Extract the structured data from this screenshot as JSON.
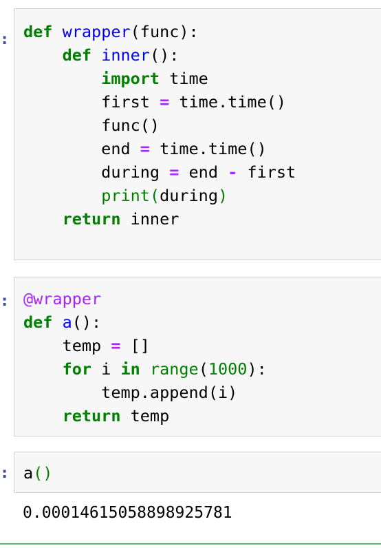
{
  "cells": [
    {
      "prompt": ":",
      "lines": [
        [
          [
            "kw",
            "def"
          ],
          [
            "t",
            " "
          ],
          [
            "def",
            "wrapper"
          ],
          [
            "t",
            "(func):"
          ]
        ],
        [
          [
            "t",
            "    "
          ],
          [
            "kw",
            "def"
          ],
          [
            "t",
            " "
          ],
          [
            "def",
            "inner"
          ],
          [
            "t",
            "():"
          ]
        ],
        [
          [
            "t",
            "        "
          ],
          [
            "kw",
            "import"
          ],
          [
            "t",
            " time"
          ]
        ],
        [
          [
            "t",
            "        first "
          ],
          [
            "op",
            "="
          ],
          [
            "t",
            " time.time()"
          ]
        ],
        [
          [
            "t",
            "        func()"
          ]
        ],
        [
          [
            "t",
            "        end "
          ],
          [
            "op",
            "="
          ],
          [
            "t",
            " time.time()"
          ]
        ],
        [
          [
            "t",
            "        during "
          ],
          [
            "op",
            "="
          ],
          [
            "t",
            " end "
          ],
          [
            "op",
            "-"
          ],
          [
            "t",
            " first"
          ]
        ],
        [
          [
            "t",
            "        "
          ],
          [
            "bi",
            "print"
          ],
          [
            "par",
            "("
          ],
          [
            "t",
            "during"
          ],
          [
            "par",
            ")"
          ]
        ],
        [
          [
            "t",
            "    "
          ],
          [
            "kw",
            "return"
          ],
          [
            "t",
            " inner"
          ]
        ]
      ]
    },
    {
      "prompt": ":",
      "lines": [
        [
          [
            "dec",
            "@wrapper"
          ]
        ],
        [
          [
            "kw",
            "def"
          ],
          [
            "t",
            " "
          ],
          [
            "def",
            "a"
          ],
          [
            "t",
            "():"
          ]
        ],
        [
          [
            "t",
            "    temp "
          ],
          [
            "op",
            "="
          ],
          [
            "t",
            " []"
          ]
        ],
        [
          [
            "t",
            "    "
          ],
          [
            "kw",
            "for"
          ],
          [
            "t",
            " i "
          ],
          [
            "kw",
            "in"
          ],
          [
            "t",
            " "
          ],
          [
            "bi",
            "range"
          ],
          [
            "t",
            "("
          ],
          [
            "num",
            "1000"
          ],
          [
            "t",
            "):"
          ]
        ],
        [
          [
            "t",
            "        temp.append(i)"
          ]
        ],
        [
          [
            "t",
            "    "
          ],
          [
            "kw",
            "return"
          ],
          [
            "t",
            " temp"
          ]
        ]
      ]
    },
    {
      "prompt": ":",
      "lines": [
        [
          [
            "t",
            "a"
          ],
          [
            "par",
            "()"
          ]
        ]
      ]
    }
  ],
  "output": "0.00014615058898925781",
  "colors": {
    "keyword": "#008000",
    "def_name": "#0000ff",
    "operator": "#aa22ff",
    "prompt": "#303f9f",
    "cell_bg": "#f7f7f7",
    "selected_border": "#66bb6a"
  }
}
